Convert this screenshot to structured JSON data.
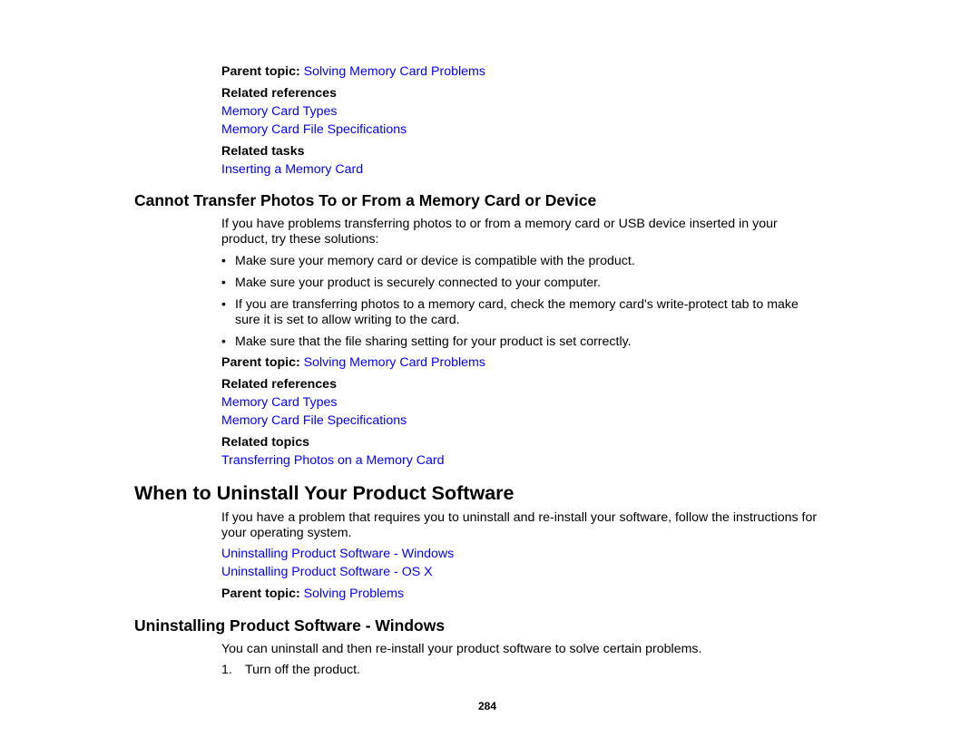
{
  "block1": {
    "parent_label": "Parent topic:",
    "parent_link": "Solving Memory Card Problems",
    "refs_heading": "Related references",
    "refs": [
      "Memory Card Types",
      "Memory Card File Specifications"
    ],
    "tasks_heading": "Related tasks",
    "tasks": [
      "Inserting a Memory Card"
    ]
  },
  "section_transfer": {
    "heading": "Cannot Transfer Photos To or From a Memory Card or Device",
    "intro_line1": "If you have problems transferring photos to or from a memory card or USB device inserted in your",
    "intro_line2": "product, try these solutions:",
    "bullet_char": "•",
    "bullets": [
      {
        "l1": "Make sure your memory card or device is compatible with the product."
      },
      {
        "l1": "Make sure your product is securely connected to your computer."
      },
      {
        "l1": "If you are transferring photos to a memory card, check the memory card's write-protect tab to make",
        "l2": "sure it is set to allow writing to the card."
      },
      {
        "l1": "Make sure that the file sharing setting for your product is set correctly."
      }
    ],
    "parent_label": "Parent topic:",
    "parent_link": "Solving Memory Card Problems",
    "refs_heading": "Related references",
    "refs": [
      "Memory Card Types",
      "Memory Card File Specifications"
    ],
    "topics_heading": "Related topics",
    "topics": [
      "Transferring Photos on a Memory Card"
    ]
  },
  "section_uninstall": {
    "heading": "When to Uninstall Your Product Software",
    "intro_line1": "If you have a problem that requires you to uninstall and re-install your software, follow the instructions for",
    "intro_line2": "your operating system.",
    "links": [
      "Uninstalling Product Software - Windows",
      "Uninstalling Product Software - OS X"
    ],
    "parent_label": "Parent topic:",
    "parent_link": "Solving Problems"
  },
  "section_windows": {
    "heading": "Uninstalling Product Software - Windows",
    "intro": "You can uninstall and then re-install your product software to solve certain problems.",
    "steps": [
      {
        "num": "1.",
        "text": "Turn off the product."
      }
    ]
  },
  "footer": {
    "page_number": "284"
  }
}
